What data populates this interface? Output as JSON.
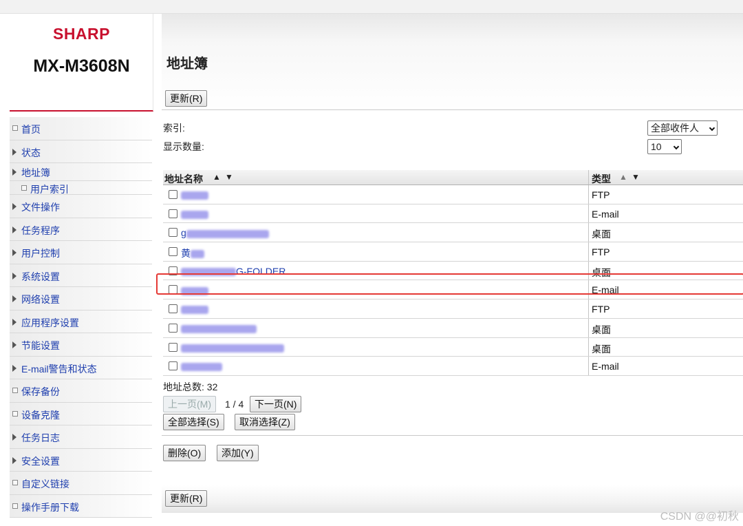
{
  "brand": {
    "logo": "SHARP",
    "model": "MX-M3608N"
  },
  "nav": [
    {
      "label": "首页",
      "marker": "bullet",
      "kind": "normal"
    },
    {
      "label": "状态",
      "marker": "arrow",
      "kind": "normal"
    },
    {
      "label": "地址簿",
      "marker": "arrow",
      "kind": "short"
    },
    {
      "label": "用户索引",
      "marker": "bullet",
      "kind": "sub"
    },
    {
      "label": "文件操作",
      "marker": "arrow",
      "kind": "normal"
    },
    {
      "label": "任务程序",
      "marker": "arrow",
      "kind": "normal"
    },
    {
      "label": "用户控制",
      "marker": "arrow",
      "kind": "normal"
    },
    {
      "label": "系统设置",
      "marker": "arrow",
      "kind": "normal"
    },
    {
      "label": "网络设置",
      "marker": "arrow",
      "kind": "normal"
    },
    {
      "label": "应用程序设置",
      "marker": "arrow",
      "kind": "normal"
    },
    {
      "label": "节能设置",
      "marker": "arrow",
      "kind": "normal"
    },
    {
      "label": "E-mail警告和状态",
      "marker": "arrow",
      "kind": "normal"
    },
    {
      "label": "保存备份",
      "marker": "bullet",
      "kind": "normal"
    },
    {
      "label": "设备克隆",
      "marker": "bullet",
      "kind": "normal"
    },
    {
      "label": "任务日志",
      "marker": "arrow",
      "kind": "normal"
    },
    {
      "label": "安全设置",
      "marker": "arrow",
      "kind": "normal"
    },
    {
      "label": "自定义链接",
      "marker": "bullet",
      "kind": "normal"
    },
    {
      "label": "操作手册下载",
      "marker": "bullet",
      "kind": "normal"
    }
  ],
  "main": {
    "title": "地址簿",
    "refresh_top": "更新(R)",
    "index_label": "索引:",
    "display_count_label": "显示数量:",
    "index_select": "全部收件人",
    "count_select": "10",
    "col_name": "地址名称",
    "col_type": "类型",
    "sort_asc_icon": "▲",
    "sort_desc_icon": "▼",
    "rows": [
      {
        "name_visible": "",
        "type": "FTP",
        "highlighted": false
      },
      {
        "name_visible": "",
        "type": "E-mail",
        "highlighted": false
      },
      {
        "name_visible": "g",
        "type": "桌面",
        "highlighted": false
      },
      {
        "name_visible": "黄",
        "type": "FTP",
        "highlighted": false
      },
      {
        "name_visible": "G-FOLDER",
        "type": "桌面",
        "highlighted": true
      },
      {
        "name_visible": "",
        "type": "E-mail",
        "highlighted": false
      },
      {
        "name_visible": "",
        "type": "FTP",
        "highlighted": false
      },
      {
        "name_visible": "",
        "type": "桌面",
        "highlighted": false
      },
      {
        "name_visible": "",
        "type": "桌面",
        "highlighted": false
      },
      {
        "name_visible": "",
        "type": "E-mail",
        "highlighted": false
      }
    ],
    "total_label": "地址总数:",
    "total_value": "32",
    "prev_page": "上一页(M)",
    "page_indicator": "1 / 4",
    "next_page": "下一页(N)",
    "select_all": "全部选择(S)",
    "deselect": "取消选择(Z)",
    "delete": "删除(O)",
    "add": "添加(Y)",
    "refresh_bottom": "更新(R)"
  },
  "watermark": "CSDN @@初秋"
}
